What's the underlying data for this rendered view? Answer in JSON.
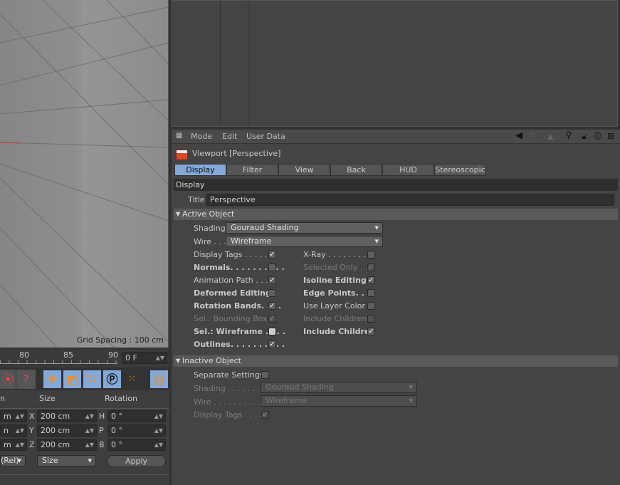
{
  "viewport": {
    "grid_spacing": "Grid Spacing : 100 cm"
  },
  "timeline": {
    "ticks": [
      "80",
      "85",
      "90"
    ],
    "frame": "0 F"
  },
  "coords": {
    "headers": {
      "position": "n",
      "size": "Size",
      "rotation": "Rotation"
    },
    "rows": [
      {
        "pos": "m",
        "axis": "X",
        "size": "200 cm",
        "raxis": "H",
        "rot": "0 °"
      },
      {
        "pos": "n",
        "axis": "Y",
        "size": "200 cm",
        "raxis": "P",
        "rot": "0 °"
      },
      {
        "pos": "m",
        "axis": "Z",
        "size": "200 cm",
        "raxis": "B",
        "rot": "0 °"
      }
    ],
    "mode": "(Rel)",
    "size_mode": "Size",
    "apply": "Apply"
  },
  "attributes": {
    "menu": [
      "Mode",
      "Edit",
      "User Data"
    ],
    "object_title": "Viewport [Perspective]",
    "tabs": [
      "Display",
      "Filter",
      "View",
      "Back",
      "HUD",
      "Stereoscopic"
    ],
    "active_tab": "Display",
    "section": "Display",
    "title_label": "Title",
    "title_value": "Perspective",
    "active_object": {
      "header": "Active Object",
      "shading_label": "Shading",
      "shading": "Gouraud Shading",
      "wire_label": "Wire . . .",
      "wire": "Wireframe",
      "left": [
        {
          "label": "Display Tags . . . . . .",
          "checked": true,
          "bold": false,
          "disabled": false
        },
        {
          "label": "Normals. . . . . . . . . .",
          "checked": false,
          "bold": true,
          "disabled": false
        },
        {
          "label": "Animation Path . . . .",
          "checked": true,
          "bold": false,
          "disabled": false
        },
        {
          "label": "Deformed Editing",
          "checked": false,
          "bold": true,
          "disabled": false
        },
        {
          "label": "Rotation Bands. . . .",
          "checked": true,
          "bold": true,
          "disabled": false
        },
        {
          "label": "Sel.: Bounding Box",
          "checked": true,
          "bold": false,
          "disabled": true
        },
        {
          "label": "Sel.: Wireframe . . . .",
          "checked": false,
          "bold": true,
          "disabled": false,
          "highlight": true
        },
        {
          "label": "Outlines. . . . . . . . . .",
          "checked": true,
          "bold": true,
          "disabled": false
        }
      ],
      "right": [
        {
          "label": "X-Ray . . . . . . . . .",
          "checked": false,
          "bold": false,
          "disabled": false
        },
        {
          "label": "Selected Only . .",
          "checked": true,
          "bold": false,
          "disabled": true
        },
        {
          "label": "Isoline Editing. .",
          "checked": true,
          "bold": true,
          "disabled": false
        },
        {
          "label": "Edge Points. . . .",
          "checked": false,
          "bold": true,
          "disabled": false
        },
        {
          "label": "Use Layer Color",
          "checked": false,
          "bold": false,
          "disabled": false
        },
        {
          "label": "Include Children",
          "checked": false,
          "bold": false,
          "disabled": true
        },
        {
          "label": "Include Children",
          "checked": true,
          "bold": true,
          "disabled": false
        }
      ]
    },
    "inactive_object": {
      "header": "Inactive Object",
      "separate_label": "Separate Settings",
      "separate_checked": false,
      "shading_label": "Shading . . . . . . . .",
      "shading": "Gouraud Shading",
      "wire_label": "Wire . . . . . . . . . . .",
      "wire": "Wireframe",
      "tags_label": "Display Tags . . . .",
      "tags_checked": true
    }
  }
}
